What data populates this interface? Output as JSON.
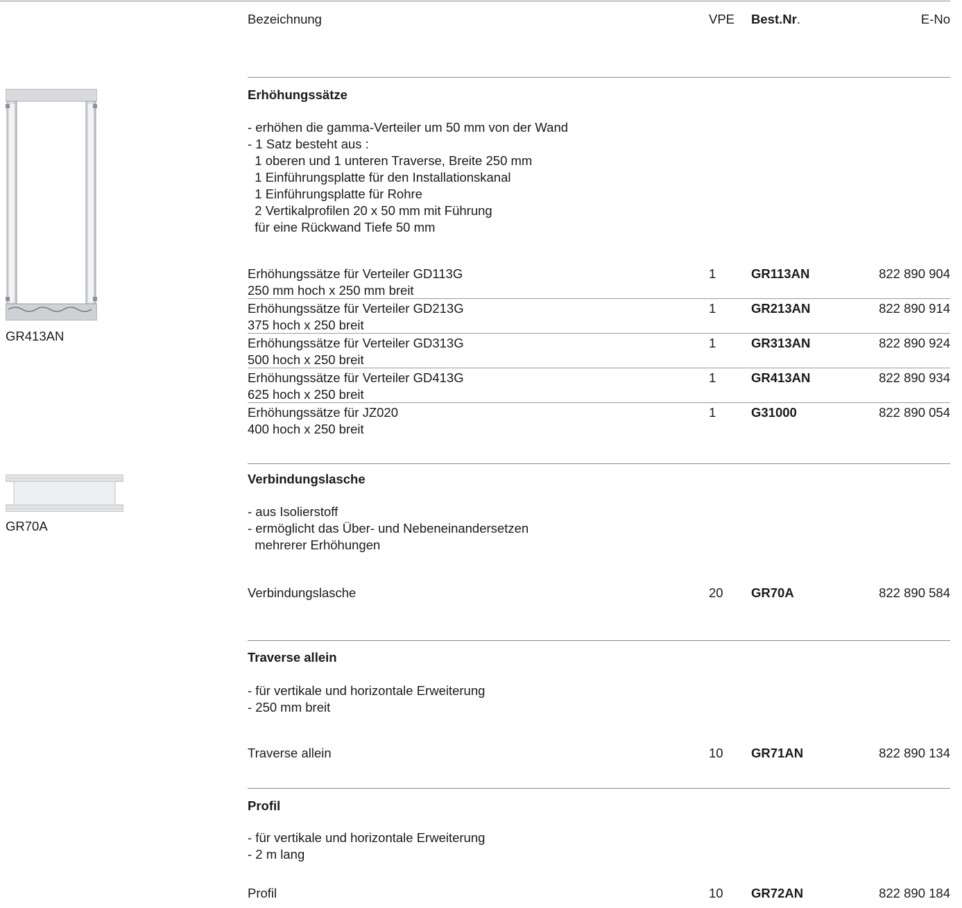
{
  "header": {
    "name": "Bezeichnung",
    "vpe": "VPE",
    "order_no": "Best.Nr",
    "order_no_dot": ".",
    "eno": "E-No"
  },
  "sections": [
    {
      "title": "Erhöhungssätze",
      "bullets": [
        "- erhöhen die gamma-Verteiler um 50 mm von der Wand",
        "- 1 Satz besteht aus :",
        "  1 oberen und 1 unteren Traverse, Breite 250 mm",
        "  1 Einführungsplatte für den Installationskanal",
        "  1 Einführungsplatte für Rohre",
        "  2 Vertikalprofilen 20 x 50 mm mit Führung",
        "  für eine Rückwand Tiefe 50 mm"
      ],
      "image_caption": "GR413AN",
      "rows": [
        {
          "line1": "Erhöhungssätze für Verteiler GD113G",
          "line2": "250 mm hoch x 250 mm breit",
          "vpe": "1",
          "order_no": "GR113AN",
          "eno": "822 890 904"
        },
        {
          "line1": "Erhöhungssätze für Verteiler GD213G",
          "line2": "375 hoch x 250 breit",
          "vpe": "1",
          "order_no": "GR213AN",
          "eno": "822 890 914"
        },
        {
          "line1": "Erhöhungssätze für Verteiler GD313G",
          "line2": "500 hoch x 250 breit",
          "vpe": "1",
          "order_no": "GR313AN",
          "eno": "822 890 924"
        },
        {
          "line1": "Erhöhungssätze für Verteiler GD413G",
          "line2": "625 hoch x 250 breit",
          "vpe": "1",
          "order_no": "GR413AN",
          "eno": "822 890 934"
        },
        {
          "line1": "Erhöhungssätze für JZ020",
          "line2": "400 hoch x 250 breit",
          "vpe": "1",
          "order_no": "G31000",
          "eno": "822 890 054"
        }
      ]
    },
    {
      "title": "Verbindungslasche",
      "bullets": [
        "- aus Isolierstoff",
        "- ermöglicht das Über- und Nebeneinandersetzen",
        "  mehrerer Erhöhungen"
      ],
      "image_caption": "GR70A",
      "rows": [
        {
          "line1": "Verbindungslasche",
          "vpe": "20",
          "order_no": "GR70A",
          "eno": "822 890 584"
        }
      ]
    },
    {
      "title": "Traverse allein",
      "bullets": [
        "- für vertikale und horizontale Erweiterung",
        "- 250 mm breit"
      ],
      "rows": [
        {
          "line1": "Traverse allein",
          "vpe": "10",
          "order_no": "GR71AN",
          "eno": "822 890 134"
        }
      ]
    },
    {
      "title": "Profil",
      "bullets": [
        "- für vertikale und horizontale Erweiterung",
        "- 2 m lang"
      ],
      "rows": [
        {
          "line1": "Profil",
          "vpe": "10",
          "order_no": "GR72AN",
          "eno": "822 890 184"
        }
      ]
    }
  ]
}
